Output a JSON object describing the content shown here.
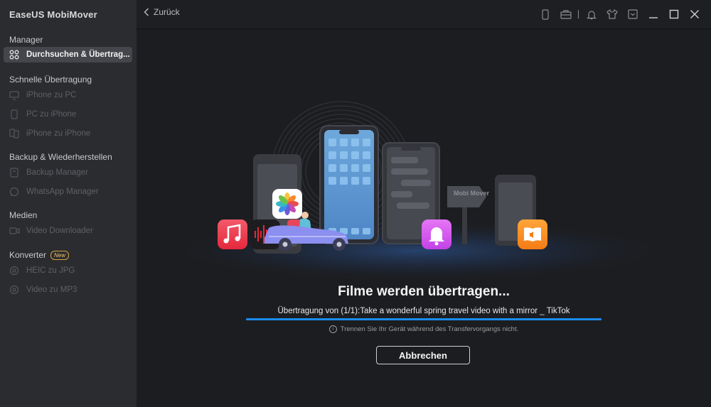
{
  "app": {
    "title": "EaseUS MobiMover"
  },
  "sidebar": {
    "sections": [
      {
        "title": "Manager",
        "items": [
          {
            "label": "Durchsuchen & Übertrag..."
          }
        ]
      },
      {
        "title": "Schnelle Übertragung",
        "items": [
          {
            "label": "iPhone zu PC"
          },
          {
            "label": "PC zu iPhone"
          },
          {
            "label": "iPhone zu iPhone"
          }
        ]
      },
      {
        "title": "Backup & Wiederherstellen",
        "items": [
          {
            "label": "Backup Manager"
          },
          {
            "label": "WhatsApp Manager"
          }
        ]
      },
      {
        "title": "Medien",
        "items": [
          {
            "label": "Video Downloader"
          }
        ]
      },
      {
        "title": "Konverter",
        "badge": "New",
        "items": [
          {
            "label": "HEIC zu JPG"
          },
          {
            "label": "Video zu MP3"
          }
        ]
      }
    ]
  },
  "topbar": {
    "back_label": "Zurück"
  },
  "illustration": {
    "sign_text": "Mobi Mover"
  },
  "transfer": {
    "title": "Filme werden übertragen...",
    "status": "Übertragung von (1/1):Take a wonderful spring travel video with a mirror _ TikTok",
    "progress": 1.0,
    "hint": "Trennen Sie Ihr Gerät während des Transfervorgangs nicht.",
    "cancel_label": "Abbrechen"
  },
  "colors": {
    "accent": "#1c8bf0",
    "sidebar_bg": "#2b2c30",
    "main_bg": "#1c1d20"
  }
}
